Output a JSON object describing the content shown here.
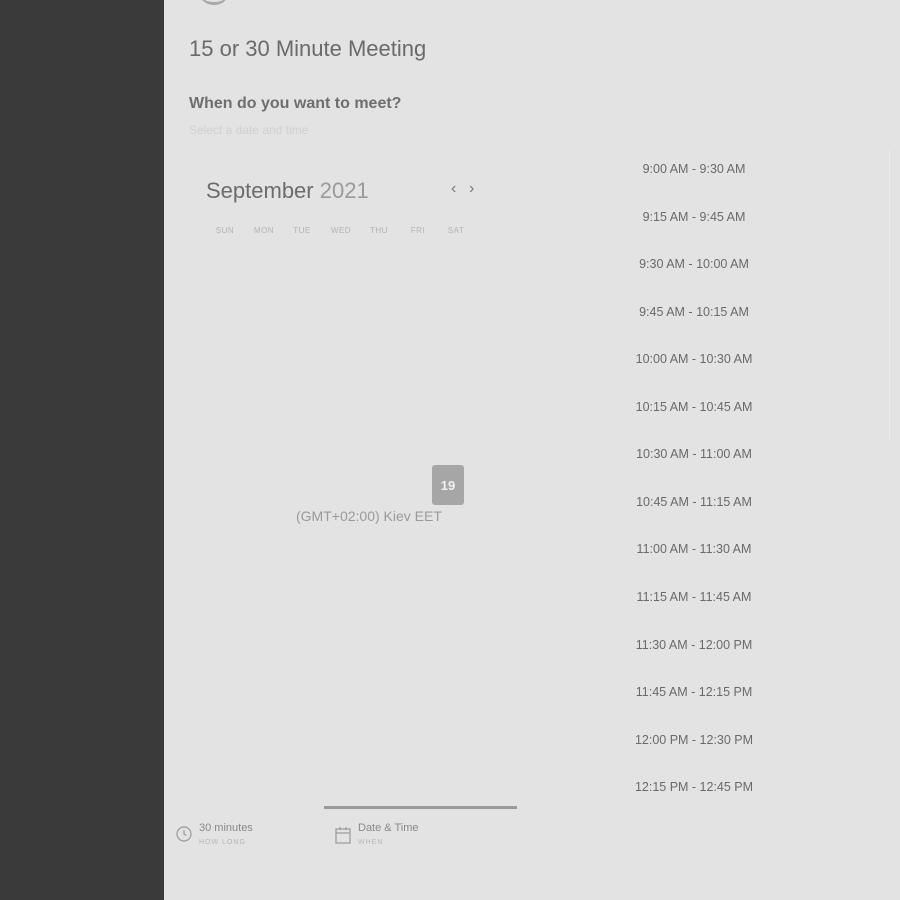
{
  "meeting": {
    "title": "15 or 30 Minute Meeting",
    "question": "When do you want to meet?",
    "subtitle": "Select a date and time"
  },
  "calendar": {
    "month": "September",
    "year": "2021",
    "weekdays": [
      "SUN",
      "MON",
      "TUE",
      "WED",
      "THU",
      "FRI",
      "SAT"
    ],
    "selected_day": "19",
    "prev_icon": "chevron-left-icon",
    "next_icon": "chevron-right-icon"
  },
  "timezone": "(GMT+02:00) Kiev EET",
  "time_slots": [
    "9:00 AM - 9:30 AM",
    "9:15 AM - 9:45 AM",
    "9:30 AM - 10:00 AM",
    "9:45 AM - 10:15 AM",
    "10:00 AM - 10:30 AM",
    "10:15 AM - 10:45 AM",
    "10:30 AM - 11:00 AM",
    "10:45 AM - 11:15 AM",
    "11:00 AM - 11:30 AM",
    "11:15 AM - 11:45 AM",
    "11:30 AM - 12:00 PM",
    "11:45 AM - 12:15 PM",
    "12:00 PM - 12:30 PM",
    "12:15 PM - 12:45 PM"
  ],
  "steps": {
    "duration": {
      "label": "30 minutes",
      "sublabel": "HOW LONG",
      "icon": "clock-icon"
    },
    "datetime": {
      "label": "Date & Time",
      "sublabel": "WHEN",
      "icon": "calendar-icon"
    }
  },
  "colors": {
    "sidebar": "#3a3a3a",
    "background": "#e3e3e3",
    "selected_day": "#a6a6a6"
  }
}
